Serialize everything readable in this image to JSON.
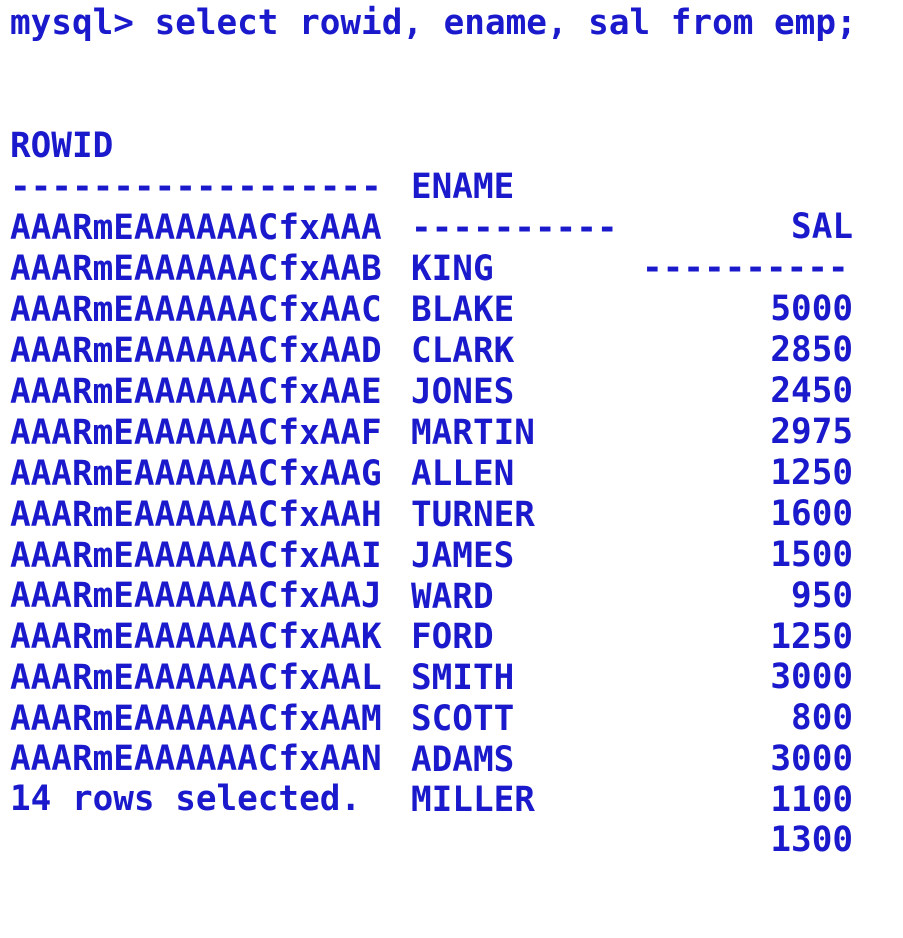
{
  "terminal": {
    "prompt": "mysql>",
    "command": "select rowid, ename, sal from emp;",
    "footer": "14 rows selected."
  },
  "table": {
    "headers": {
      "rowid": "ROWID",
      "ename": "ENAME",
      "sal": "SAL"
    },
    "dashes": {
      "rowid": "------------------",
      "ename": "----------",
      "sal": "----------"
    },
    "rows": [
      {
        "rowid": "AAARmEAAAAAACfxAAA",
        "ename": "KING",
        "sal": "5000"
      },
      {
        "rowid": "AAARmEAAAAAACfxAAB",
        "ename": "BLAKE",
        "sal": "2850"
      },
      {
        "rowid": "AAARmEAAAAAACfxAAC",
        "ename": "CLARK",
        "sal": "2450"
      },
      {
        "rowid": "AAARmEAAAAAACfxAAD",
        "ename": "JONES",
        "sal": "2975"
      },
      {
        "rowid": "AAARmEAAAAAACfxAAE",
        "ename": "MARTIN",
        "sal": "1250"
      },
      {
        "rowid": "AAARmEAAAAAACfxAAF",
        "ename": "ALLEN",
        "sal": "1600"
      },
      {
        "rowid": "AAARmEAAAAAACfxAAG",
        "ename": "TURNER",
        "sal": "1500"
      },
      {
        "rowid": "AAARmEAAAAAACfxAAH",
        "ename": "JAMES",
        "sal": "950"
      },
      {
        "rowid": "AAARmEAAAAAACfxAAI",
        "ename": "WARD",
        "sal": "1250"
      },
      {
        "rowid": "AAARmEAAAAAACfxAAJ",
        "ename": "FORD",
        "sal": "3000"
      },
      {
        "rowid": "AAARmEAAAAAACfxAAK",
        "ename": "SMITH",
        "sal": "800"
      },
      {
        "rowid": "AAARmEAAAAAACfxAAL",
        "ename": "SCOTT",
        "sal": "3000"
      },
      {
        "rowid": "AAARmEAAAAAACfxAAM",
        "ename": "ADAMS",
        "sal": "1100"
      },
      {
        "rowid": "AAARmEAAAAAACfxAAN",
        "ename": "MILLER",
        "sal": "1300"
      }
    ]
  },
  "colors": {
    "text": "#1a1acc",
    "background": "#ffffff"
  }
}
